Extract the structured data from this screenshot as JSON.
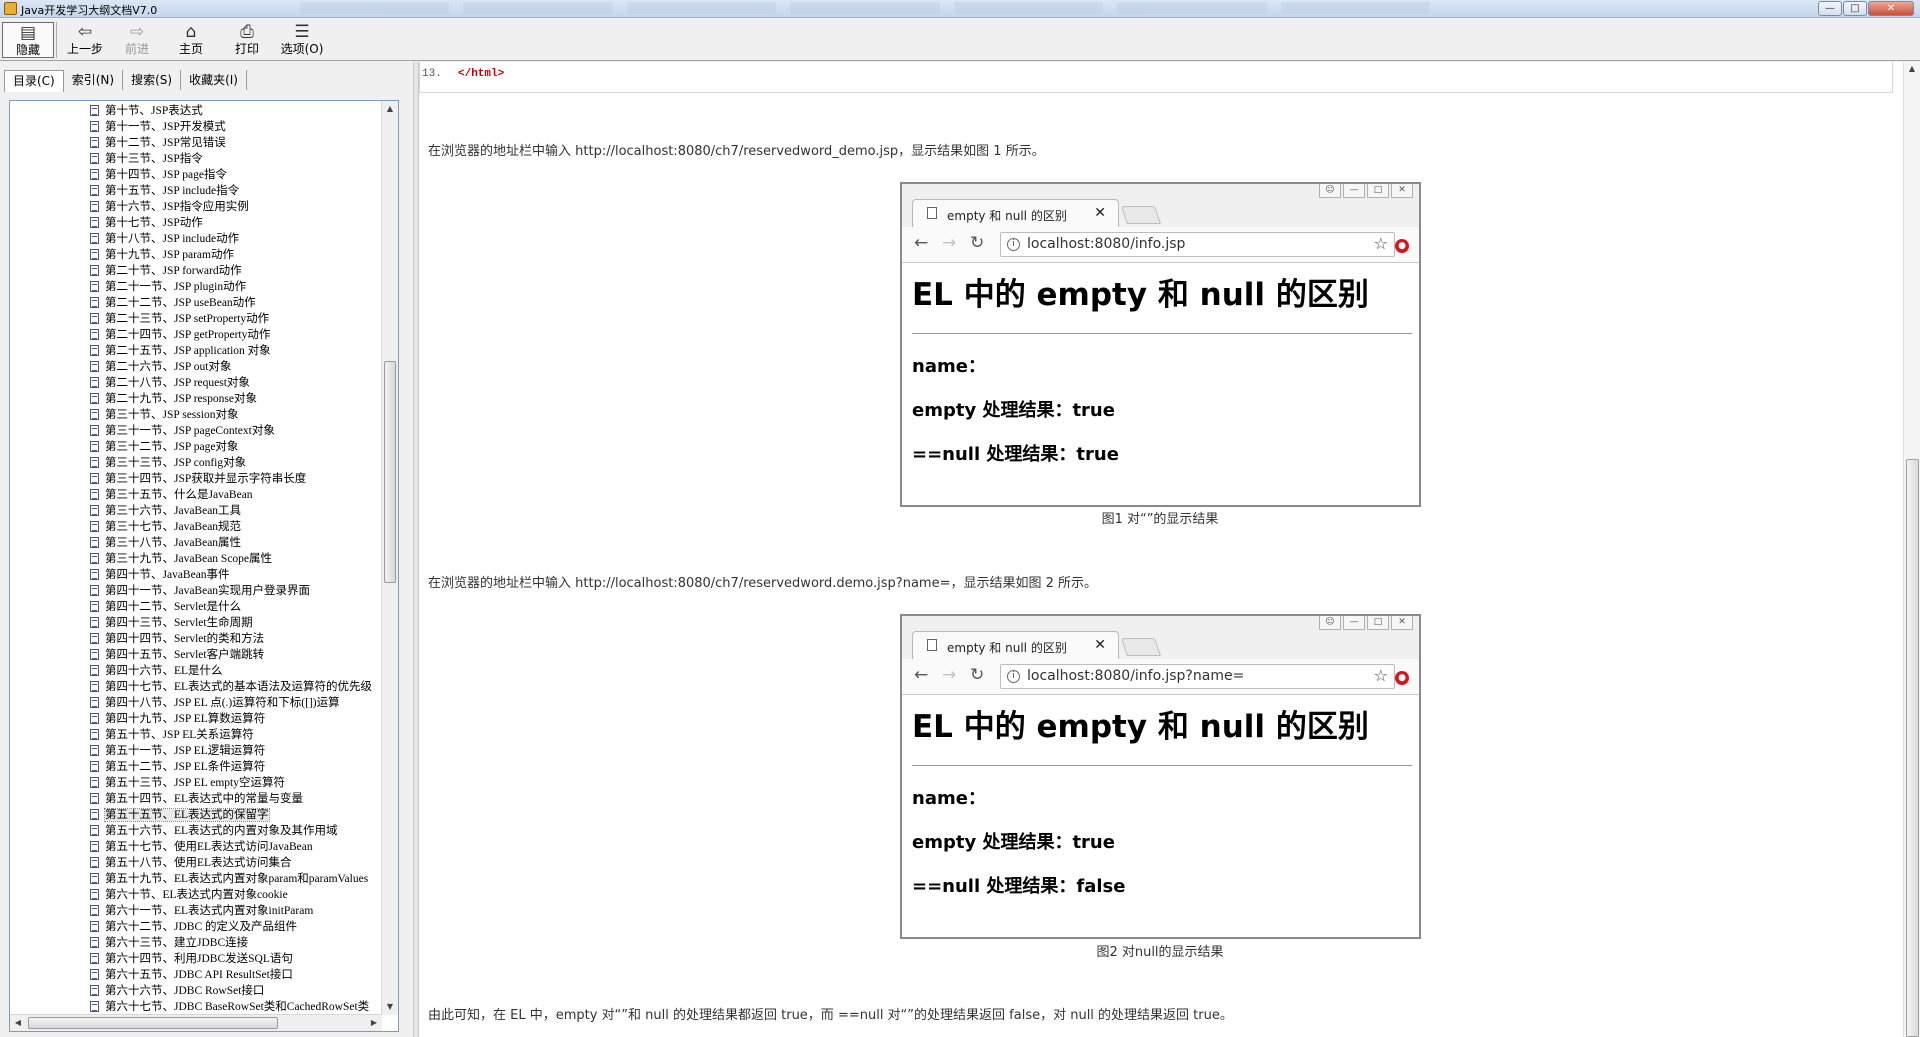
{
  "window": {
    "title": "Java开发学习大纲文档V7.0",
    "controls": {
      "min": "—",
      "max": "□",
      "close": "✕"
    }
  },
  "toolbar": {
    "hide": "隐藏",
    "back": "上一步",
    "forward": "前进",
    "home": "主页",
    "print": "打印",
    "options": "选项(O)"
  },
  "tabs": [
    "目录(C)",
    "索引(N)",
    "搜索(S)",
    "收藏夹(I)"
  ],
  "tree": {
    "selected_index": 44,
    "items": [
      "第十节、JSP表达式",
      "第十一节、JSP开发模式",
      "第十二节、JSP常见错误",
      "第十三节、JSP指令",
      "第十四节、JSP page指令",
      "第十五节、JSP include指令",
      "第十六节、JSP指令应用实例",
      "第十七节、JSP动作",
      "第十八节、JSP include动作",
      "第十九节、JSP param动作",
      "第二十节、JSP forward动作",
      "第二十一节、JSP plugin动作",
      "第二十二节、JSP useBean动作",
      "第二十三节、JSP setProperty动作",
      "第二十四节、JSP getProperty动作",
      "第二十五节、JSP application 对象",
      "第二十六节、JSP out对象",
      "第二十八节、JSP request对象",
      "第二十九节、JSP response对象",
      "第三十节、JSP session对象",
      "第三十一节、JSP pageContext对象",
      "第三十二节、JSP page对象",
      "第三十三节、JSP config对象",
      "第三十四节、JSP获取并显示字符串长度",
      "第三十五节、什么是JavaBean",
      "第三十六节、JavaBean工具",
      "第三十七节、JavaBean规范",
      "第三十八节、JavaBean属性",
      "第三十九节、JavaBean Scope属性",
      "第四十节、JavaBean事件",
      "第四十一节、JavaBean实现用户登录界面",
      "第四十二节、Servlet是什么",
      "第四十三节、Servlet生命周期",
      "第四十四节、Servlet的类和方法",
      "第四十五节、Servlet客户端跳转",
      "第四十六节、EL是什么",
      "第四十七节、EL表达式的基本语法及运算符的优先级",
      "第四十八节、JSP EL 点(.)运算符和下标([])运算",
      "第四十九节、JSP EL算数运算符",
      "第五十节、JSP EL关系运算符",
      "第五十一节、JSP EL逻辑运算符",
      "第五十二节、JSP EL条件运算符",
      "第五十三节、JSP EL empty空运算符",
      "第五十四节、EL表达式中的常量与变量",
      "第五十五节、EL表达式的保留字",
      "第五十六节、EL表达式的内置对象及其作用域",
      "第五十七节、使用EL表达式访问JavaBean",
      "第五十八节、使用EL表达式访问集合",
      "第五十九节、EL表达式内置对象param和paramValues",
      "第六十节、EL表达式内置对象cookie",
      "第六十一节、EL表达式内置对象initParam",
      "第六十二节、JDBC 的定义及产品组件",
      "第六十三节、建立JDBC连接",
      "第六十四节、利用JDBC发送SQL语句",
      "第六十五节、JDBC API ResultSet接口",
      "第六十六节、JDBC RowSet接口",
      "第六十七节、JDBC BaseRowSet类和CachedRowSet类"
    ]
  },
  "content": {
    "code_line_number": "13.",
    "code_tag": "</html>",
    "para1": "在浏览器的地址栏中输入 http://localhost:8080/ch7/reservedword_demo.jsp，显示结果如图 1 所示。",
    "fig1": {
      "tab_title": "empty 和 null 的区别",
      "url": "localhost:8080/info.jsp",
      "heading": "EL 中的 empty 和 null 的区别",
      "name_line": "name：",
      "empty_line": "empty 处理结果：true",
      "null_line": "==null 处理结果：true",
      "caption": "图1 对“”的显示结果"
    },
    "para2": "在浏览器的地址栏中输入 http://localhost:8080/ch7/reservedword.demo.jsp?name=，显示结果如图 2 所示。",
    "fig2": {
      "tab_title": "empty 和 null 的区别",
      "url": "localhost:8080/info.jsp?name=",
      "heading": "EL 中的 empty 和 null 的区别",
      "name_line": "name：",
      "empty_line": "empty 处理结果：true",
      "null_line": "==null 处理结果：false",
      "caption": "图2 对null的显示结果"
    },
    "para3": "由此可知，在 EL 中，empty 对“”和 null 的处理结果都返回 true，而 ==null 对“”的处理结果返回 false，对 null 的处理结果返回 true。"
  },
  "icons": {
    "back": "back-arrow-icon",
    "forward": "forward-arrow-icon",
    "home": "home-icon",
    "print": "printer-icon",
    "options": "options-icon",
    "document": "document-icon"
  }
}
